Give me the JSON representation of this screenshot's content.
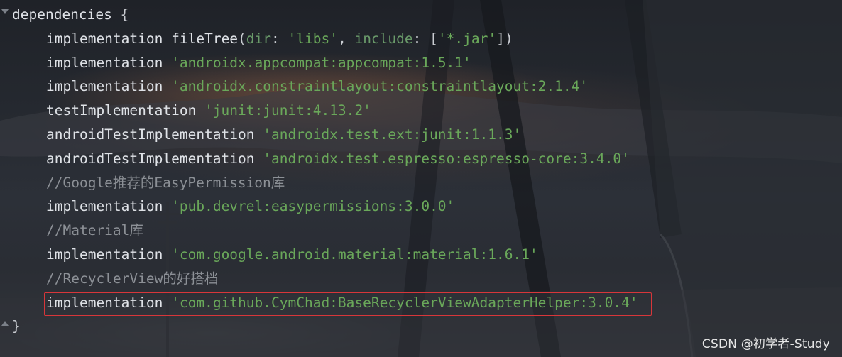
{
  "editor": {
    "lines": [
      {
        "type": "block-open",
        "keyword": "dependencies",
        "brace": "{"
      },
      {
        "type": "call",
        "method": "implementation",
        "fn": "fileTree",
        "open": "(",
        "arg1_name": "dir",
        "colon1": ": ",
        "arg1_value": "'libs'",
        "sep": ", ",
        "arg2_name": "include",
        "colon2": ": ",
        "arr_open": "[",
        "arg2_value": "'*.jar'",
        "arr_close": "]",
        "close": ")"
      },
      {
        "type": "dep",
        "method": "implementation",
        "value": "'androidx.appcompat:appcompat:1.5.1'"
      },
      {
        "type": "dep",
        "method": "implementation",
        "value": "'androidx.constraintlayout:constraintlayout:2.1.4'"
      },
      {
        "type": "dep",
        "method": "testImplementation",
        "value": "'junit:junit:4.13.2'"
      },
      {
        "type": "dep",
        "method": "androidTestImplementation",
        "value": "'androidx.test.ext:junit:1.1.3'"
      },
      {
        "type": "dep",
        "method": "androidTestImplementation",
        "value": "'androidx.test.espresso:espresso-core:3.4.0'"
      },
      {
        "type": "comment",
        "text": "//Google推荐的EasyPermission库"
      },
      {
        "type": "dep",
        "method": "implementation",
        "value": "'pub.devrel:easypermissions:3.0.0'"
      },
      {
        "type": "comment",
        "text": "//Material库"
      },
      {
        "type": "dep",
        "method": "implementation",
        "value": "'com.google.android.material:material:1.6.1'"
      },
      {
        "type": "comment",
        "text": "//RecyclerView的好搭档"
      },
      {
        "type": "dep",
        "method": "implementation",
        "value": "'com.github.CymChad:BaseRecyclerViewAdapterHelper:3.0.4'"
      },
      {
        "type": "block-close",
        "brace": "}"
      }
    ]
  },
  "watermark": "CSDN @初学者-Study",
  "colors": {
    "string": "#6aa85a",
    "comment": "#8c9096",
    "text": "#dfe2e7",
    "highlight_border": "#d8363a"
  }
}
